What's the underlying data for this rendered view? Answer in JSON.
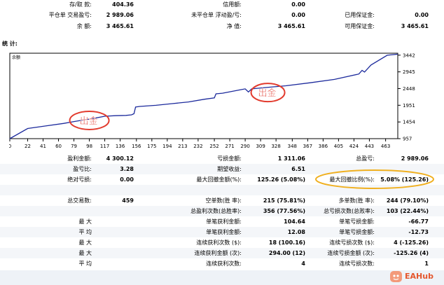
{
  "account": {
    "rows": [
      [
        {
          "label": "存/取 款:",
          "value": "404.36"
        },
        {
          "label": "信用额:",
          "value": "0.00"
        },
        {
          "label": "",
          "value": ""
        }
      ],
      [
        {
          "label": "平仓单 交易盈亏:",
          "value": "2 989.06"
        },
        {
          "label": "未平仓单 浮动盈/亏:",
          "value": "0.00"
        },
        {
          "label": "已用保证金:",
          "value": "0.00"
        }
      ],
      [
        {
          "label": "余 额:",
          "value": "3 465.61"
        },
        {
          "label": "净 值:",
          "value": "3 465.61"
        },
        {
          "label": "可用保证金:",
          "value": "3 465.61"
        }
      ]
    ]
  },
  "section_title": "统 计:",
  "chart": {
    "legend_label": "余额",
    "annotations": [
      "出金",
      "出金"
    ]
  },
  "chart_data": {
    "type": "line",
    "title": "",
    "series": [
      {
        "name": "余额",
        "points": [
          [
            0,
            957
          ],
          [
            22,
            1260
          ],
          [
            44,
            1335
          ],
          [
            66,
            1410
          ],
          [
            79,
            1465
          ],
          [
            90,
            1510
          ],
          [
            100,
            1545
          ],
          [
            117,
            1625
          ],
          [
            130,
            1640
          ],
          [
            143,
            1650
          ],
          [
            150,
            1665
          ],
          [
            153,
            1700
          ],
          [
            155,
            1900
          ],
          [
            160,
            1915
          ],
          [
            180,
            1950
          ],
          [
            200,
            2000
          ],
          [
            220,
            2050
          ],
          [
            240,
            2130
          ],
          [
            252,
            2170
          ],
          [
            254,
            2290
          ],
          [
            262,
            2310
          ],
          [
            290,
            2440
          ],
          [
            294,
            2345
          ],
          [
            298,
            2440
          ],
          [
            320,
            2490
          ],
          [
            340,
            2530
          ],
          [
            370,
            2620
          ],
          [
            400,
            2720
          ],
          [
            430,
            2880
          ],
          [
            434,
            2990
          ],
          [
            437,
            2940
          ],
          [
            445,
            3150
          ],
          [
            465,
            3440
          ],
          [
            478,
            3470
          ]
        ]
      }
    ],
    "x_ticks": [
      0,
      22,
      41,
      60,
      79,
      98,
      117,
      136,
      156,
      175,
      194,
      213,
      232,
      252,
      271,
      290,
      309,
      328,
      348,
      367,
      386,
      405,
      424,
      443,
      463
    ],
    "y_ticks": [
      957,
      1454,
      1951,
      2448,
      2945,
      3442
    ],
    "xlim": [
      0,
      478
    ],
    "ylim": [
      957,
      3500
    ],
    "grid": false,
    "legend_position": "top-left",
    "line_color": "#1c2a9c"
  },
  "stats": {
    "rows": [
      [
        {
          "label": "盈利金额:",
          "value": "4 300.12"
        },
        {
          "label": "亏损金额:",
          "value": "1 311.06"
        },
        {
          "label": "总盈亏:",
          "value": "2 989.06"
        }
      ],
      [
        {
          "label": "盈亏比:",
          "value": "3.28"
        },
        {
          "label": "期望收益:",
          "value": "6.51"
        },
        {
          "label": "",
          "value": ""
        }
      ],
      [
        {
          "label": "绝对亏损:",
          "value": "0.00"
        },
        {
          "label": "最大回撤金额(%):",
          "value": "125.26 (5.08%)"
        },
        {
          "label": "最大回撤比例(%):",
          "value": "5.08% (125.26)"
        }
      ],
      [
        {
          "label": "",
          "value": ""
        },
        {
          "label": "",
          "value": ""
        },
        {
          "label": "",
          "value": ""
        }
      ],
      [
        {
          "label": "总交易数:",
          "value": "459"
        },
        {
          "label": "空单数(胜 率):",
          "value": "215 (75.81%)"
        },
        {
          "label": "多单数(胜 率):",
          "value": "244 (79.10%)"
        }
      ],
      [
        {
          "label": "",
          "value": ""
        },
        {
          "label": "总盈利次数(总胜率):",
          "value": "356 (77.56%)"
        },
        {
          "label": "总亏损次数(总败率):",
          "value": "103 (22.44%)"
        }
      ],
      [
        {
          "label": "最 大",
          "value": ""
        },
        {
          "label": "单笔获利金额:",
          "value": "104.64"
        },
        {
          "label": "单笔亏损金额:",
          "value": "-66.77"
        }
      ],
      [
        {
          "label": "平 均",
          "value": ""
        },
        {
          "label": "单笔获利金额:",
          "value": "12.08"
        },
        {
          "label": "单笔亏损金额:",
          "value": "-12.73"
        }
      ],
      [
        {
          "label": "最 大",
          "value": ""
        },
        {
          "label": "连续获利次数 ($):",
          "value": "18 (100.16)"
        },
        {
          "label": "连续亏损次数 ($):",
          "value": "4 (-125.26)"
        }
      ],
      [
        {
          "label": "最 大",
          "value": ""
        },
        {
          "label": "连续获利金额 (次):",
          "value": "294.00 (12)"
        },
        {
          "label": "连续亏损金额 (次):",
          "value": "-125.26 (4)"
        }
      ],
      [
        {
          "label": "平 均",
          "value": ""
        },
        {
          "label": "连续获利次数:",
          "value": "4"
        },
        {
          "label": "连续亏损次数:",
          "value": "1"
        }
      ]
    ]
  },
  "brand": {
    "name": "EAHub"
  },
  "colors": {
    "highlight_red": "#e23b2e",
    "highlight_orange": "#f0b020",
    "row_alt": "#f4f6f9"
  }
}
